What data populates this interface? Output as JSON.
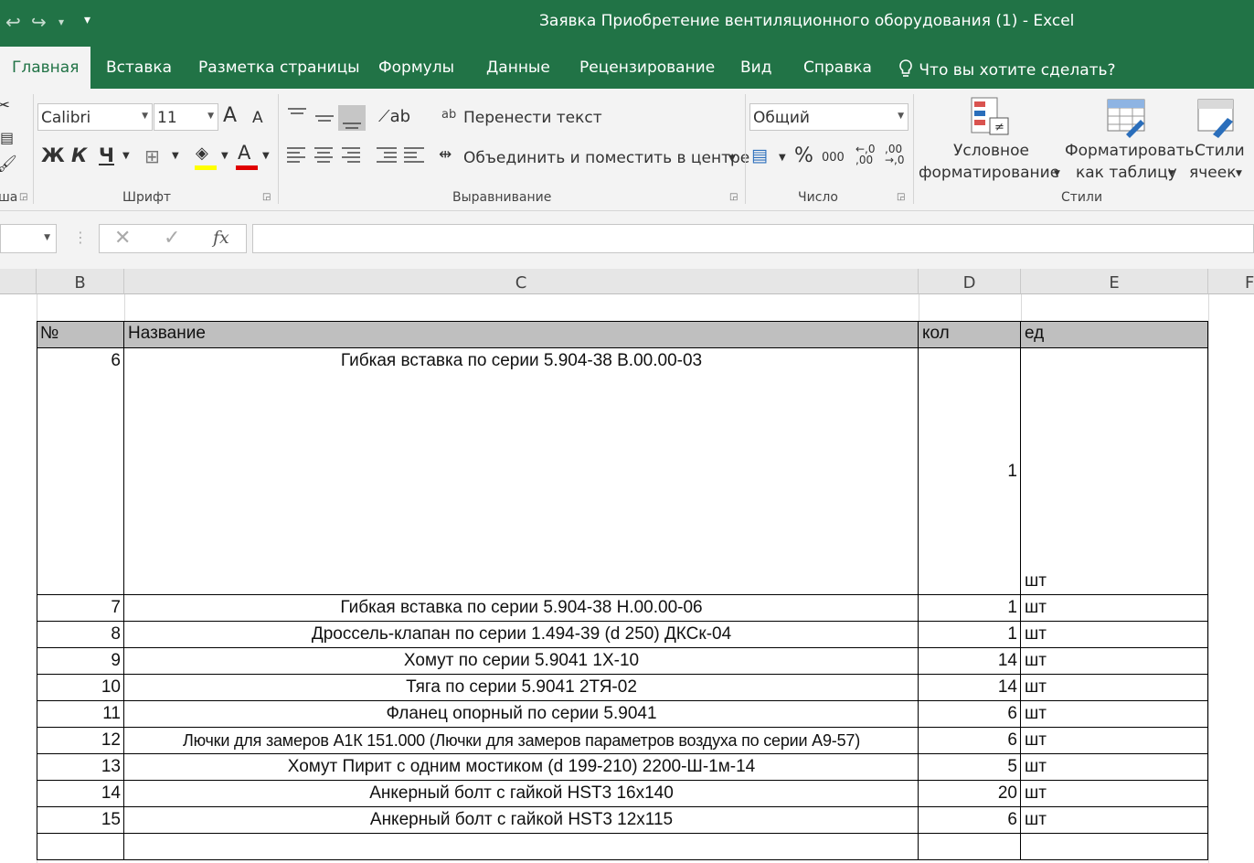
{
  "window": {
    "title": "Заявка Приобретение вентиляционного оборудования (1)  -  Excel"
  },
  "qat": {
    "redo_icon": "↪",
    "customize_icon": "▾"
  },
  "tabs": [
    {
      "label": "Главная"
    },
    {
      "label": "Вставка"
    },
    {
      "label": "Разметка страницы"
    },
    {
      "label": "Формулы"
    },
    {
      "label": "Данные"
    },
    {
      "label": "Рецензирование"
    },
    {
      "label": "Вид"
    },
    {
      "label": "Справка"
    }
  ],
  "tellme": {
    "label": "Что вы хотите сделать?"
  },
  "ribbon": {
    "clipboard_label_partial": "ша",
    "font": {
      "group_label": "Шрифт",
      "name": "Calibri",
      "size": "11",
      "bold": "Ж",
      "italic": "К",
      "underline": "Ч",
      "grow": "A",
      "shrink": "A",
      "fontcolor": "A",
      "highlight_color": "#ffff00",
      "font_color": "#e00000"
    },
    "alignment": {
      "group_label": "Выравнивание",
      "wrap_text": "Перенести текст",
      "merge_center": "Объединить и поместить в центре",
      "wrap_icon": "ab"
    },
    "number": {
      "group_label": "Число",
      "format": "Общий",
      "percent": "%",
      "thousands": "000",
      "inc_decimal": "←,0 ,00",
      "dec_decimal": ",00 →,0"
    },
    "styles": {
      "group_label": "Стили",
      "conditional_line1": "Условное",
      "conditional_line2": "форматирование",
      "table_line1": "Форматировать",
      "table_line2": "как таблицу",
      "cell_styles_line1": "Стили",
      "cell_styles_line2": "ячеек"
    }
  },
  "formula_bar": {
    "cancel": "✕",
    "enter": "✓",
    "fx": "fx",
    "value": ""
  },
  "columns": [
    "B",
    "C",
    "D",
    "E",
    "F"
  ],
  "table": {
    "headers": {
      "num": "№",
      "name": "Название",
      "qty": "кол",
      "unit": "ед"
    },
    "rows": [
      {
        "num": "6",
        "name": "Гибкая вставка по серии 5.904-38 В.00.00-03",
        "qty": "1",
        "unit": "шт"
      },
      {
        "num": "7",
        "name": "Гибкая вставка по серии 5.904-38 Н.00.00-06",
        "qty": "1",
        "unit": "шт"
      },
      {
        "num": "8",
        "name": "Дроссель-клапан по серии 1.494-39 (d 250) ДКСк-04",
        "qty": "1",
        "unit": "шт"
      },
      {
        "num": "9",
        "name": "Хомут по серии 5.9041 1Х-10",
        "qty": "14",
        "unit": "шт"
      },
      {
        "num": "10",
        "name": "Тяга по серии 5.9041 2ТЯ-02",
        "qty": "14",
        "unit": "шт"
      },
      {
        "num": "11",
        "name": "Фланец опорный по серии 5.9041",
        "qty": "6",
        "unit": "шт"
      },
      {
        "num": "12",
        "name": "Лючки для замеров А1К 151.000 (Лючки для замеров параметров воздуха по серии А9-57)",
        "qty": "6",
        "unit": "шт"
      },
      {
        "num": "13",
        "name": "Хомут Пирит с одним мостиком (d 199-210) 2200-Ш-1м-14",
        "qty": "5",
        "unit": "шт"
      },
      {
        "num": "14",
        "name": "Анкерный болт с гайкой HST3 16х140",
        "qty": "20",
        "unit": "шт"
      },
      {
        "num": "15",
        "name": "Анкерный болт с гайкой HST3 12х115",
        "qty": "6",
        "unit": "шт"
      }
    ]
  },
  "colors": {
    "excel_green": "#217346",
    "header_fill": "#bfbfbf"
  }
}
